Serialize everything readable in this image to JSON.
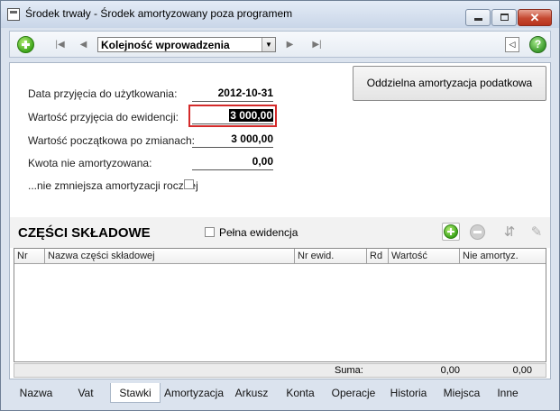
{
  "window": {
    "title": "Środek trwały - Środek amortyzowany poza programem",
    "controls": {
      "minimize": "",
      "maximize": "",
      "close": "✕"
    }
  },
  "toolbar": {
    "order_select": "Kolejność wprowadzenia",
    "help": "?"
  },
  "form": {
    "separate_amortization_button": "Oddzielna amortyzacja podatkowa",
    "fields": [
      {
        "label": "Data przyjęcia do użytkowania:",
        "value": "2012-10-31"
      },
      {
        "label": "Wartość przyjęcia do ewidencji:",
        "value": "3 000,00"
      },
      {
        "label": "Wartość początkowa po zmianach:",
        "value": "3 000,00"
      },
      {
        "label": "Kwota nie amortyzowana:",
        "value": "0,00"
      }
    ],
    "no_reduce_label": "...nie zmniejsza amortyzacji rocznej",
    "no_reduce_checked": false
  },
  "parts": {
    "title": "CZĘŚCI SKŁADOWE",
    "full_records_label": "Pełna ewidencja",
    "full_records_checked": false,
    "columns": [
      "Nr",
      "Nazwa części składowej",
      "Nr ewid.",
      "Rd",
      "Wartość",
      "Nie amortyz."
    ],
    "rows": [],
    "sum_label": "Suma:",
    "sum_value": "0,00",
    "sum_non_amort": "0,00"
  },
  "tabs": [
    "Nazwa",
    "Vat",
    "Stawki",
    "Amortyzacja",
    "Arkusz",
    "Konta",
    "Operacje",
    "Historia",
    "Miejsca",
    "Inne"
  ],
  "active_tab": "Stawki",
  "colors": {
    "highlight": "#d42a2a",
    "green": "#3ca419"
  }
}
